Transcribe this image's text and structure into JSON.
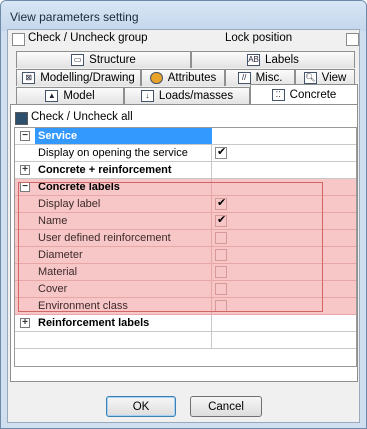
{
  "window": {
    "title": "View parameters setting"
  },
  "top": {
    "check_uncheck_group": "Check / Uncheck group",
    "lock_position": "Lock position"
  },
  "tabs": {
    "row1": [
      {
        "label": "Structure",
        "icon": "structure-icon"
      },
      {
        "label": "Labels",
        "icon": "labels-icon"
      }
    ],
    "row2": [
      {
        "label": "Modelling/Drawing",
        "icon": "modelling-icon"
      },
      {
        "label": "Attributes",
        "icon": "attributes-icon"
      },
      {
        "label": "Misc.",
        "icon": "misc-icon"
      },
      {
        "label": "View",
        "icon": "view-icon"
      }
    ],
    "row3": [
      {
        "label": "Model",
        "icon": "model-icon"
      },
      {
        "label": "Loads/masses",
        "icon": "loads-icon"
      },
      {
        "label": "Concrete",
        "icon": "concrete-icon",
        "active": true
      }
    ]
  },
  "check_all": "Check / Uncheck all",
  "grid": {
    "rows": [
      {
        "label": "Service",
        "header": true,
        "expander": "−",
        "selected": true
      },
      {
        "label": "Display on opening the service",
        "checked": true
      },
      {
        "label": "Concrete + reinforcement",
        "header": true,
        "expander": "+"
      },
      {
        "label": "Concrete labels",
        "header": true,
        "expander": "−",
        "highlight": true
      },
      {
        "label": "Display label",
        "checked": true,
        "highlight": true
      },
      {
        "label": "Name",
        "checked": true,
        "highlight": true
      },
      {
        "label": "User defined reinforcement",
        "checked": false,
        "highlight": true
      },
      {
        "label": "Diameter",
        "checked": false,
        "highlight": true
      },
      {
        "label": "Material",
        "checked": false,
        "highlight": true
      },
      {
        "label": "Cover",
        "checked": false,
        "highlight": true
      },
      {
        "label": "Environment class",
        "checked": false,
        "highlight": true
      },
      {
        "label": "Reinforcement labels",
        "header": true,
        "expander": "+"
      }
    ]
  },
  "buttons": {
    "ok": "OK",
    "cancel": "Cancel"
  },
  "colors": {
    "highlight": "#f7c6c6",
    "selected": "#3399ff",
    "frame": "#cfdfef"
  }
}
